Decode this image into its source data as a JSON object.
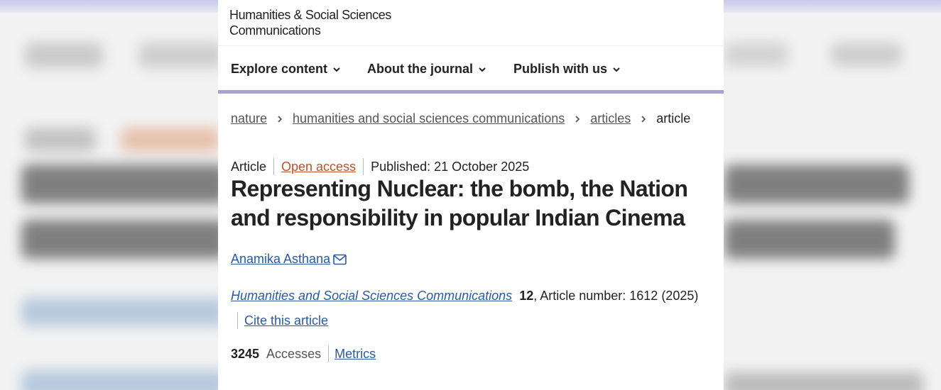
{
  "site": {
    "brand_line1": "Humanities & Social Sciences",
    "brand_line2": "Communications"
  },
  "nav": {
    "items": [
      {
        "label": "Explore content"
      },
      {
        "label": "About the journal"
      },
      {
        "label": "Publish with us"
      }
    ]
  },
  "breadcrumb": {
    "items": [
      "nature",
      "humanities and social sciences communications",
      "articles",
      "article"
    ]
  },
  "article": {
    "type": "Article",
    "access": "Open access",
    "published": "Published: 21 October 2025",
    "title": "Representing Nuclear: the bomb, the Nation and responsibility in popular Indian Cinema",
    "author": "Anamika Asthana",
    "journal": "Humanities and Social Sciences Communications",
    "volume": "12",
    "article_number": ", Article number: 1612 (2025)",
    "cite_label": "Cite this article",
    "accesses_count": "3245",
    "accesses_label": "Accesses",
    "metrics_label": "Metrics"
  },
  "colors": {
    "link": "#2a5aa0",
    "open_access": "#b5522c",
    "nav_underline": "#a9a3cf"
  },
  "icons": [
    "chevron-down-icon",
    "chevron-right-icon",
    "mail-icon"
  ]
}
